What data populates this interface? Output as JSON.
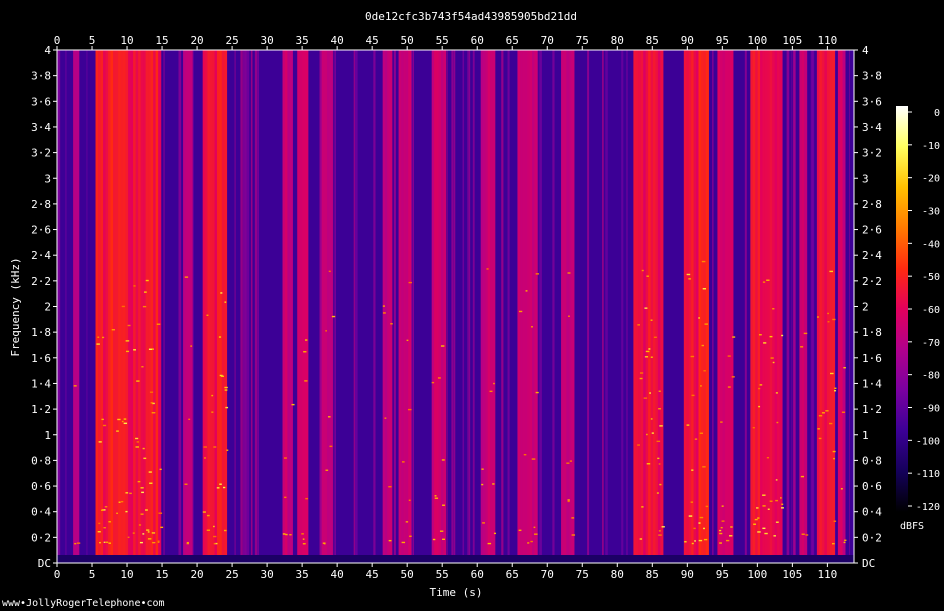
{
  "chart_data": {
    "type": "heatmap",
    "title": "0de12cfc3b743f54ad43985905bd21dd",
    "xlabel": "Time (s)",
    "ylabel": "Frequency (kHz)",
    "x_ticks": [
      "0",
      "5",
      "10",
      "15",
      "20",
      "25",
      "30",
      "35",
      "40",
      "45",
      "50",
      "55",
      "60",
      "65",
      "70",
      "75",
      "80",
      "85",
      "90",
      "95",
      "100",
      "105",
      "110"
    ],
    "y_ticks": [
      "DC",
      "0·2",
      "0·4",
      "0·6",
      "0·8",
      "1",
      "1·2",
      "1·4",
      "1·6",
      "1·8",
      "2",
      "2·2",
      "2·4",
      "2·6",
      "2·8",
      "3",
      "3·2",
      "3·4",
      "3·6",
      "3·8",
      "4"
    ],
    "xlim": [
      0,
      113.8
    ],
    "ylim": [
      0,
      4
    ],
    "colorbar": {
      "label": "dBFS",
      "ticks": [
        "0",
        "-10",
        "-20",
        "-30",
        "-40",
        "-50",
        "-60",
        "-70",
        "-80",
        "-90",
        "-100",
        "-110",
        "-120"
      ],
      "range": [
        -120,
        0
      ],
      "colors": [
        "#000000",
        "#14005a",
        "#3c0096",
        "#7a00a0",
        "#b0008c",
        "#e2005c",
        "#ff2a10",
        "#ff7a00",
        "#ffc000",
        "#ffff60",
        "#ffffff"
      ]
    },
    "activity_segments": [
      {
        "start": 5.5,
        "end": 14.8,
        "level": 0.95
      },
      {
        "start": 20.8,
        "end": 24.2,
        "level": 0.9
      },
      {
        "start": 18.0,
        "end": 19.3,
        "level": 0.55
      },
      {
        "start": 2.3,
        "end": 3.1,
        "level": 0.45
      },
      {
        "start": 32.2,
        "end": 33.6,
        "level": 0.55
      },
      {
        "start": 34.3,
        "end": 35.8,
        "level": 0.6
      },
      {
        "start": 37.8,
        "end": 39.3,
        "level": 0.6
      },
      {
        "start": 46.5,
        "end": 47.8,
        "level": 0.55
      },
      {
        "start": 48.8,
        "end": 50.5,
        "level": 0.55
      },
      {
        "start": 53.5,
        "end": 55.5,
        "level": 0.6
      },
      {
        "start": 60.5,
        "end": 62.5,
        "level": 0.55
      },
      {
        "start": 65.8,
        "end": 68.5,
        "level": 0.55
      },
      {
        "start": 72.0,
        "end": 73.8,
        "level": 0.5
      },
      {
        "start": 82.3,
        "end": 86.5,
        "level": 0.9
      },
      {
        "start": 89.5,
        "end": 93.0,
        "level": 0.95
      },
      {
        "start": 94.3,
        "end": 96.5,
        "level": 0.75
      },
      {
        "start": 99.0,
        "end": 103.5,
        "level": 0.9
      },
      {
        "start": 106.0,
        "end": 107.0,
        "level": 0.55
      },
      {
        "start": 108.5,
        "end": 111.0,
        "level": 0.85
      },
      {
        "start": 111.5,
        "end": 112.5,
        "level": 0.6
      }
    ],
    "grid": false,
    "legend": "colorbar-right"
  },
  "footer": {
    "credit": "www•JollyRogerTelephone•com"
  }
}
